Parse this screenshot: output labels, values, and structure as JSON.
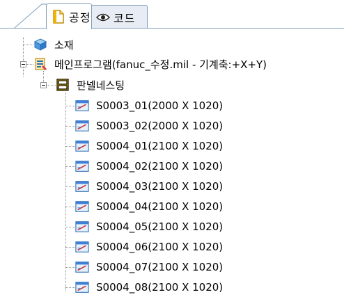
{
  "tabs": [
    {
      "label": "공정",
      "icon": "document-icon",
      "active": true
    },
    {
      "label": "코드",
      "icon": "eye-icon",
      "active": false
    }
  ],
  "tree": {
    "material": {
      "label": "소재",
      "icon": "cube-icon"
    },
    "program": {
      "label": "메인프로그램(fanuc_수정.mil - 기계축:+X+Y)",
      "icon": "program-icon"
    },
    "nesting": {
      "label": "판넬네스팅",
      "icon": "panel-icon"
    },
    "sheets": [
      "S0003_01(2000 X 1020)",
      "S0003_02(2000 X 1020)",
      "S0004_01(2100 X 1020)",
      "S0004_02(2100 X 1020)",
      "S0004_03(2100 X 1020)",
      "S0004_04(2100 X 1020)",
      "S0004_05(2100 X 1020)",
      "S0004_06(2100 X 1020)",
      "S0004_07(2100 X 1020)",
      "S0004_08(2100 X 1020)"
    ]
  },
  "colors": {
    "accent": "#3f7fd6",
    "tab_border": "#7f9db9",
    "tree_line": "#8f8f8f"
  }
}
